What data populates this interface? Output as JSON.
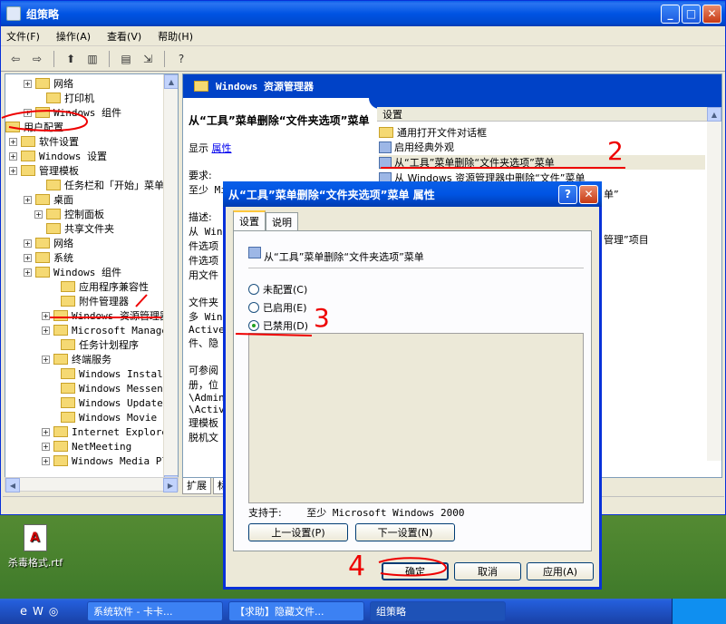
{
  "window": {
    "title": "组策略"
  },
  "menu": [
    "文件(F)",
    "操作(A)",
    "查看(V)",
    "帮助(H)"
  ],
  "tree": [
    {
      "label": "网络",
      "mono": false
    },
    {
      "label": "打印机",
      "mono": false
    },
    {
      "label": "Windows 组件",
      "mono": true
    },
    {
      "label": "用户配置",
      "mono": false
    },
    {
      "label": "软件设置",
      "mono": false
    },
    {
      "label": "Windows 设置",
      "mono": true
    },
    {
      "label": "管理模板",
      "mono": false
    },
    {
      "label": "任务栏和「开始」菜单",
      "mono": false
    },
    {
      "label": "桌面",
      "mono": false
    },
    {
      "label": "控制面板",
      "mono": false
    },
    {
      "label": "共享文件夹",
      "mono": false
    },
    {
      "label": "网络",
      "mono": false
    },
    {
      "label": "系统",
      "mono": false
    },
    {
      "label": "Windows 组件",
      "mono": true
    },
    {
      "label": "应用程序兼容性",
      "mono": false
    },
    {
      "label": "附件管理器",
      "mono": false
    },
    {
      "label": "Windows 资源管理器",
      "mono": true
    },
    {
      "label": "Microsoft Managem",
      "mono": true
    },
    {
      "label": "任务计划程序",
      "mono": false
    },
    {
      "label": "终端服务",
      "mono": false
    },
    {
      "label": "Windows Installer",
      "mono": true
    },
    {
      "label": "Windows Messenger",
      "mono": true
    },
    {
      "label": "Windows Update",
      "mono": true
    },
    {
      "label": "Windows Movie Mak",
      "mono": true
    },
    {
      "label": "Internet Explorer",
      "mono": true
    },
    {
      "label": "NetMeeting",
      "mono": true
    },
    {
      "label": "Windows Media Pla",
      "mono": true
    }
  ],
  "right": {
    "header": "Windows 资源管理器",
    "desc_title": "从“工具”菜单删除“文件夹选项”菜单",
    "show_label": "显示",
    "show_link": "属性",
    "req_label": "要求:",
    "req_value": "至少 Mi",
    "desc_label": "描述:",
    "desc_lines": [
      "从 Wind",
      "件选项",
      "件选项",
      "用文件"
    ],
    "desc2_lines": [
      "文件夹",
      "多 Wind",
      "Active",
      "件、隐"
    ],
    "desc3_lines": [
      "可参阅",
      "册，位",
      "\\Admin",
      "\\Active",
      "理模板",
      "脱机文"
    ],
    "list_header": "设置",
    "list": [
      "通用打开文件对话框",
      "启用经典外观",
      "从“工具”菜单删除“文件夹选项”菜单",
      "从 Windows 资源管理器中删除“文件”菜单"
    ],
    "list_tail": [
      "单”",
      "",
      "",
      "管理”项目"
    ],
    "tabs": [
      "扩展",
      "标准"
    ]
  },
  "dialog": {
    "title": "从“工具”菜单删除“文件夹选项”菜单 属性",
    "tabs": [
      "设置",
      "说明"
    ],
    "setting_name": "从“工具”菜单删除“文件夹选项”菜单",
    "radios": [
      {
        "label": "未配置(C)",
        "checked": false
      },
      {
        "label": "已启用(E)",
        "checked": false
      },
      {
        "label": "已禁用(D)",
        "checked": true
      }
    ],
    "supported_label": "支持于:",
    "supported_value": "至少 Microsoft Windows 2000",
    "prev_button": "上一设置(P)",
    "next_button": "下一设置(N)",
    "ok_button": "确定",
    "cancel_button": "取消",
    "apply_button": "应用(A)"
  },
  "desktop_icon": "杀毒格式.rtf",
  "taskbar": [
    {
      "label": "系统软件 - 卡卡...",
      "active": false
    },
    {
      "label": "【求助】隐藏文件...",
      "active": false
    },
    {
      "label": "组策略",
      "active": true
    }
  ],
  "annotations": [
    "2",
    "3",
    "4"
  ]
}
